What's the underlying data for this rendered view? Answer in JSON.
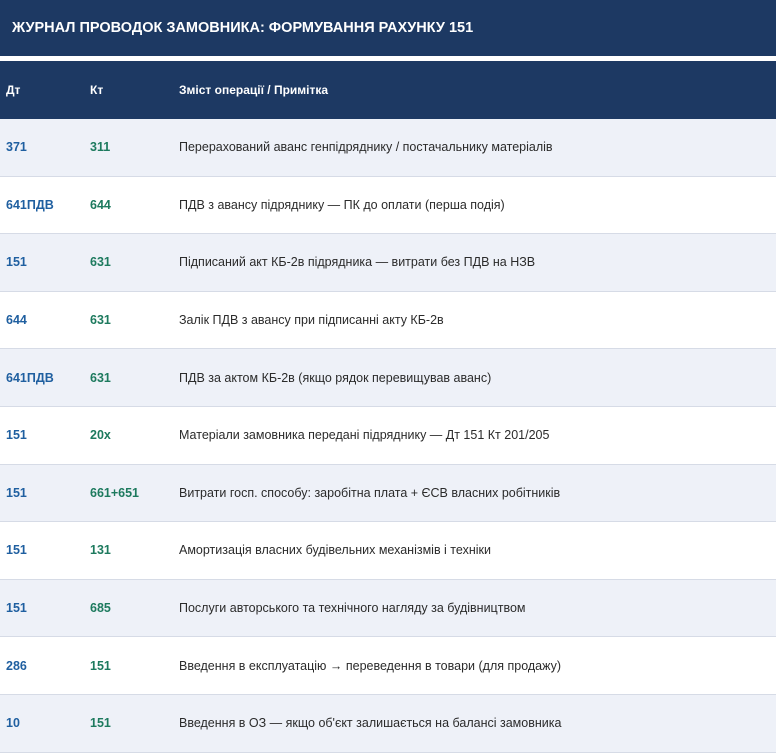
{
  "title": "ЖУРНАЛ ПРОВОДОК ЗАМОВНИКА: ФОРМУВАННЯ РАХУНКУ 151",
  "columns": {
    "dt": "Дт",
    "kt": "Кт",
    "desc": "Зміст операції / Примітка"
  },
  "rows": [
    {
      "dt": "371",
      "kt": "311",
      "desc": "Перерахований аванс генпідряднику / постачальнику матеріалів"
    },
    {
      "dt": "641ПДВ",
      "kt": "644",
      "desc": "ПДВ з авансу підряднику — ПК до оплати (перша подія)"
    },
    {
      "dt": "151",
      "kt": "631",
      "desc": "Підписаний акт КБ-2в підрядника — витрати без ПДВ на НЗВ"
    },
    {
      "dt": "644",
      "kt": "631",
      "desc": "Залік ПДВ з авансу при підписанні акту КБ-2в"
    },
    {
      "dt": "641ПДВ",
      "kt": "631",
      "desc": "ПДВ за актом КБ-2в (якщо рядок перевищував аванс)"
    },
    {
      "dt": "151",
      "kt": "20х",
      "desc": "Матеріали замовника передані підряднику — Дт 151 Кт 201/205"
    },
    {
      "dt": "151",
      "kt": "661+651",
      "desc": "Витрати госп. способу: заробітна плата + ЄСВ власних робітників"
    },
    {
      "dt": "151",
      "kt": "131",
      "desc": "Амортизація власних будівельних механізмів і техніки"
    },
    {
      "dt": "151",
      "kt": "685",
      "desc": "Послуги авторського та технічного нагляду за будівництвом"
    },
    {
      "dt": "286",
      "kt": "151",
      "desc": "Введення в експлуатацію → переведення в товари (для продажу)"
    },
    {
      "dt": "10",
      "kt": "151",
      "desc": "Введення в ОЗ — якщо об'єкт залишається на балансі замовника"
    }
  ],
  "colors": {
    "header_bg": "#1d3963",
    "dt_text": "#1f5fa0",
    "kt_text": "#1d7a5e",
    "row_alt_bg": "#eef1f8"
  }
}
